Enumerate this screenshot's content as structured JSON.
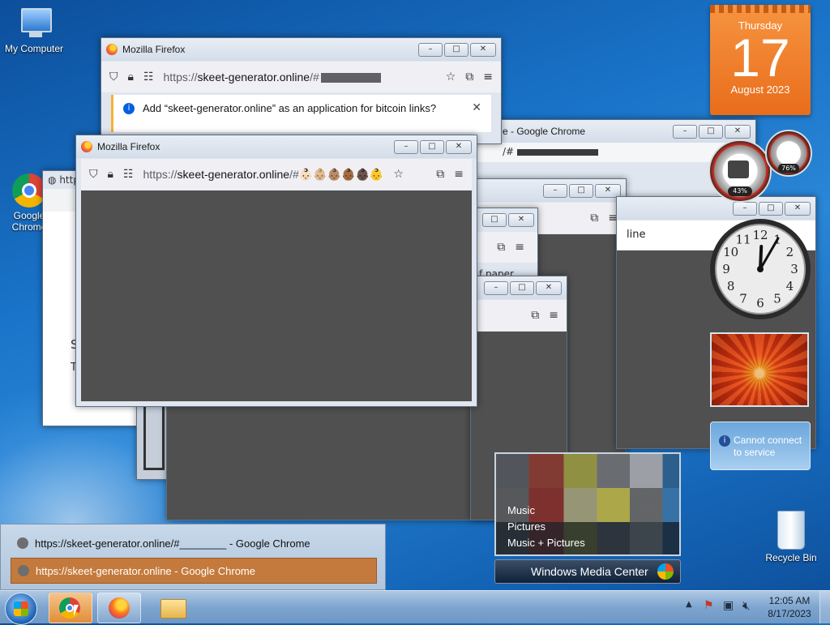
{
  "desktop": {
    "icons": [
      {
        "label": "My Computer"
      },
      {
        "label": "Google Chrome"
      },
      {
        "label": "Recycle Bin"
      }
    ]
  },
  "firefox_back": {
    "title": "Mozilla Firefox",
    "url_prefix": "https://",
    "url_host": "skeet-generator.online",
    "url_suffix": "/#",
    "notification": "Add “skeet-generator.online” as an application for bitcoin links?"
  },
  "firefox_front": {
    "title": "Mozilla Firefox",
    "url_prefix": "https://",
    "url_host": "skeet-generator.online",
    "url_suffix": "/#👶🏻👶🏼👶🏽👶🏾👶🏿👶"
  },
  "chrome_back": {
    "title_fragment": "e - Google Chrome",
    "url_fragment": "/#"
  },
  "misc_fragments": {
    "line": "line",
    "paper": "f paper",
    "s_char": "S",
    "t_char": "T",
    "http_frag": "http"
  },
  "calendar": {
    "day_name": "Thursday",
    "day": "17",
    "month_year": "August 2023"
  },
  "cpu_meter": {
    "cpu": "43%",
    "memory": "76%"
  },
  "clock": {
    "numerals": [
      "12",
      "1",
      "2",
      "3",
      "4",
      "5",
      "6",
      "7",
      "8",
      "9",
      "10",
      "11"
    ],
    "hour": 12,
    "minute": 5
  },
  "feed_gadget": {
    "message": "Cannot connect to service"
  },
  "media_center": {
    "items": [
      "Music",
      "Pictures",
      "Music + Pictures"
    ],
    "brand": "Windows Media Center"
  },
  "taskbar_preview": {
    "rows": [
      {
        "label": "https://skeet-generator.online/#________ - Google Chrome",
        "selected": false
      },
      {
        "label": "https://skeet-generator.online - Google Chrome",
        "selected": true
      }
    ]
  },
  "tray": {
    "time": "12:05 AM",
    "date": "8/17/2023"
  }
}
